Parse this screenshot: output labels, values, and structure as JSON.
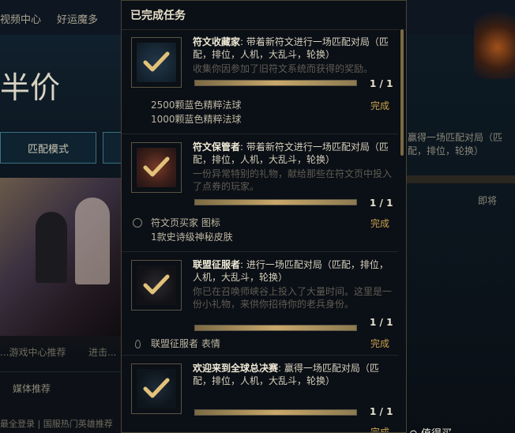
{
  "background": {
    "nav_items": [
      "视频中心",
      "好运魔多"
    ],
    "promo_text": "半价",
    "mode_button": "匹配模式",
    "left_links": [
      "...游戏中心推荐",
      "进击..."
    ],
    "media_section": "媒体推荐",
    "footer_left": "最全登录 | 国服热门英雄推荐",
    "right_quest_text": "赢得一场匹配对局（匹配，排位，轮换）",
    "right_link": "即将",
    "bottom_logo": "⊙ 值得买"
  },
  "panel": {
    "title": "已完成任务"
  },
  "tasks": [
    {
      "name": "符文收藏家",
      "requirement": ": 带着新符文进行一场匹配对局（匹配，排位，人机，大乱斗，轮换）",
      "description": "收集你因参加了旧符文系统而获得的奖励。",
      "progress": 1,
      "count": "1 / 1",
      "rewards": [
        "2500颗蓝色精粹法球",
        "1000颗蓝色精粹法球"
      ],
      "status": "完成"
    },
    {
      "name": "符文保管者",
      "requirement": ": 带着新符文进行一场匹配对局（匹配，排位，人机，大乱斗，轮换）",
      "description": "一份异常特别的礼物，献给那些在符文页中投入了点券的玩家。",
      "progress": 1,
      "count": "1 / 1",
      "rewards": [
        "符文页买家 图标",
        "1款史诗级神秘皮肤"
      ],
      "status": "完成"
    },
    {
      "name": "联盟征服者",
      "requirement": ": 进行一场匹配对局（匹配，排位，人机，大乱斗，轮换）",
      "description": "你已在召唤师峡谷上投入了大量时间。这里是一份小礼物，来供你招待你的老兵身份。",
      "progress": 1,
      "count": "1 / 1",
      "rewards": [
        "联盟征服者 表情"
      ],
      "status": "完成"
    },
    {
      "name": "欢迎来到全球总决赛",
      "requirement": ": 赢得一场匹配对局（匹配，排位，人机，大乱斗，轮换）",
      "description": "",
      "progress": 1,
      "count": "1 / 1",
      "rewards": [],
      "status": "完成"
    }
  ],
  "colors": {
    "accent_gold": "#c9a250",
    "panel_bg": "#0b0f16",
    "border": "#4a4333"
  },
  "icons": [
    "checkmark-icon",
    "summoner-icon-reward",
    "emote-drop-icon"
  ]
}
